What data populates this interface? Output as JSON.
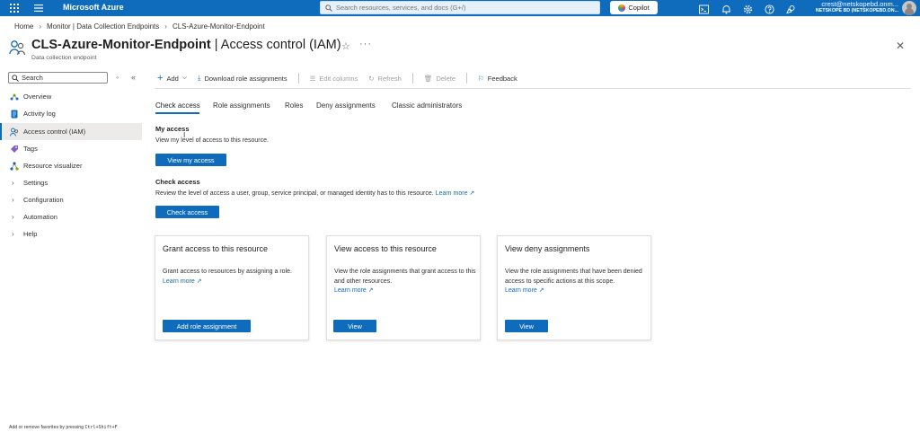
{
  "topbar": {
    "brand": "Microsoft Azure",
    "search_placeholder": "Search resources, services, and docs (G+/)",
    "copilot_label": "Copilot",
    "account_name": "crest@netskopebd.onm...",
    "account_directory": "NETSKOPE BD (NETSKOPEBD.ON..."
  },
  "breadcrumb": {
    "items": [
      "Home",
      "Monitor | Data Collection Endpoints",
      "CLS-Azure-Monitor-Endpoint"
    ]
  },
  "header": {
    "title_resource": "CLS-Azure-Monitor-Endpoint",
    "title_section": " | Access control (IAM)",
    "subtitle": "Data collection endpoint"
  },
  "sidebar": {
    "search_value": "Search",
    "items": [
      {
        "label": "Overview",
        "icon": "overview-icon"
      },
      {
        "label": "Activity log",
        "icon": "activity-log-icon"
      },
      {
        "label": "Access control (IAM)",
        "icon": "iam-icon"
      },
      {
        "label": "Tags",
        "icon": "tag-icon"
      },
      {
        "label": "Resource visualizer",
        "icon": "visualizer-icon"
      },
      {
        "label": "Settings",
        "icon": "chevron-right-icon"
      },
      {
        "label": "Configuration",
        "icon": "chevron-right-icon"
      },
      {
        "label": "Automation",
        "icon": "chevron-right-icon"
      },
      {
        "label": "Help",
        "icon": "chevron-right-icon"
      }
    ]
  },
  "toolbar": {
    "add": "Add",
    "download": "Download role assignments",
    "edit_columns": "Edit columns",
    "refresh": "Refresh",
    "delete": "Delete",
    "feedback": "Feedback"
  },
  "tabs": [
    "Check access",
    "Role assignments",
    "Roles",
    "Deny assignments",
    "Classic administrators"
  ],
  "my_access": {
    "heading": "My access",
    "description": "View my level of access to this resource.",
    "button": "View my access"
  },
  "check_access": {
    "heading": "Check access",
    "description": "Review the level of access a user, group, service principal, or managed identity has to this resource.",
    "learn_more": "Learn more",
    "button": "Check access"
  },
  "cards": [
    {
      "title": "Grant access to this resource",
      "description": "Grant access to resources by assigning a role.",
      "learn_more": "Learn more",
      "button": "Add role assignment"
    },
    {
      "title": "View access to this resource",
      "description": "View the role assignments that grant access to this and other resources.",
      "learn_more": "Learn more",
      "button": "View"
    },
    {
      "title": "View deny assignments",
      "description": "View the role assignments that have been denied access to specific actions at this scope.",
      "learn_more": "Learn more",
      "button": "View"
    }
  ],
  "footer": {
    "hint_prefix": "Add or remove favorites by pressing ",
    "hint_keys": "Ctrl+Shift+F"
  },
  "colors": {
    "brand_blue": "#0f6cbd",
    "active_nav_bg": "#edebe9"
  }
}
